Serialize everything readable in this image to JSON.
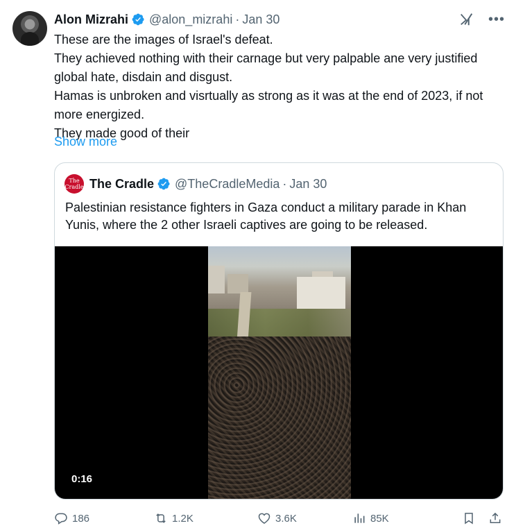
{
  "tweet": {
    "author_name": "Alon Mizrahi",
    "handle": "@alon_mizrahi",
    "separator": "·",
    "date": "Jan 30",
    "lines": [
      "These are the images of Israel's defeat.",
      "They achieved nothing with their carnage but very palpable ane very justified global hate, disdain and disgust.",
      "Hamas is unbroken and visrtually as strong as it was at the end of 2023, if not more energized.",
      "They made good of their"
    ],
    "show_more": "Show more"
  },
  "quote": {
    "author_name": "The Cradle",
    "handle": "@TheCradleMedia",
    "separator": "·",
    "date": "Jan 30",
    "avatar_text": "The Cradle",
    "text": "Palestinian resistance fighters in Gaza conduct a military parade in Khan Yunis, where the 2 other Israeli captives are going to be released.",
    "video_time": "0:16"
  },
  "actions": {
    "replies": "186",
    "reposts": "1.2K",
    "likes": "3.6K",
    "views": "85K"
  },
  "icons": {
    "verified": "verified-badge-icon",
    "grok": "grok-icon",
    "more": "more-icon",
    "reply": "reply-icon",
    "repost": "repost-icon",
    "like": "heart-icon",
    "views": "views-icon",
    "bookmark": "bookmark-icon",
    "share": "share-icon"
  },
  "colors": {
    "accent": "#1d9bf0",
    "muted": "#536471",
    "text": "#0f1419",
    "border": "#cfd9de",
    "cradle_red": "#c8102e"
  }
}
